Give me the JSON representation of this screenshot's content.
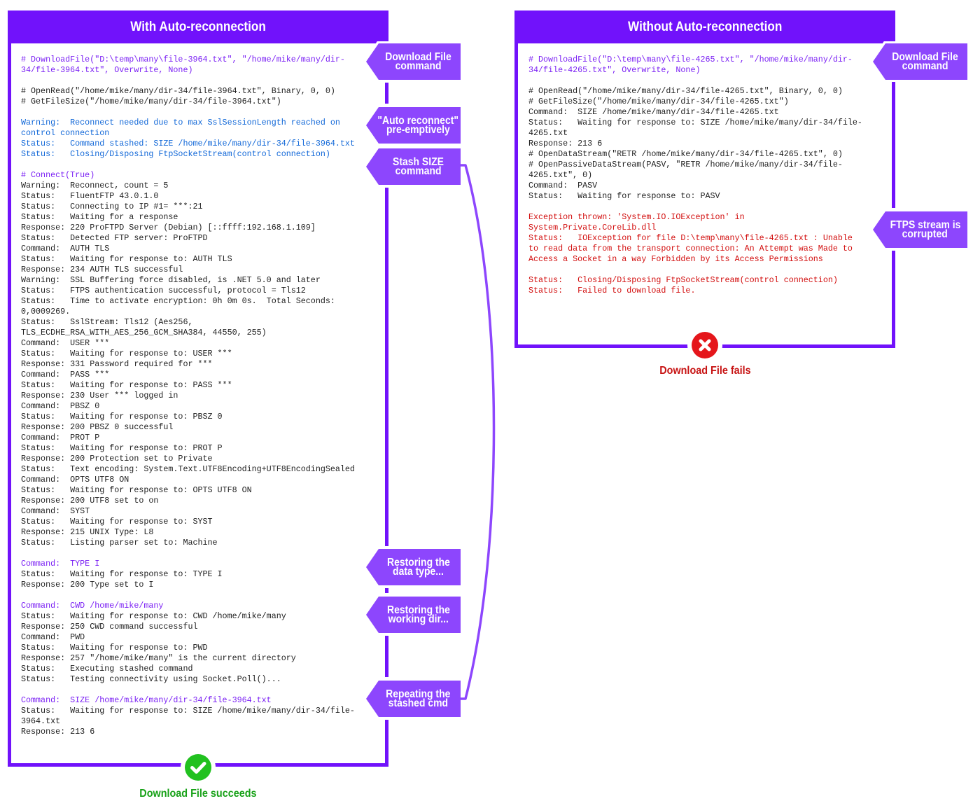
{
  "colors": {
    "frame": "#7112fb",
    "tag": "#8d46fd",
    "success": "#21c11f",
    "success_text": "#17a117",
    "failure": "#e5161b",
    "failure_text": "#c71313"
  },
  "panels": {
    "with": {
      "title": "With Auto-reconnection",
      "log_lines": [
        {
          "t": "# DownloadFile(\"D:\\temp\\many\\file-3964.txt\", \"/home/mike/many/dir-",
          "c": "purple"
        },
        {
          "t": "34/file-3964.txt\", Overwrite, None)",
          "c": "purple"
        },
        {
          "t": "",
          "c": "plain"
        },
        {
          "t": "# OpenRead(\"/home/mike/many/dir-34/file-3964.txt\", Binary, 0, 0)",
          "c": "plain"
        },
        {
          "t": "# GetFileSize(\"/home/mike/many/dir-34/file-3964.txt\")",
          "c": "plain"
        },
        {
          "t": "",
          "c": "plain"
        },
        {
          "t": "Warning:  Reconnect needed due to max SslSessionLength reached on",
          "c": "blue"
        },
        {
          "t": "control connection",
          "c": "blue"
        },
        {
          "t": "Status:   Command stashed: SIZE /home/mike/many/dir-34/file-3964.txt",
          "c": "blue"
        },
        {
          "t": "Status:   Closing/Disposing FtpSocketStream(control connection)",
          "c": "blue"
        },
        {
          "t": "",
          "c": "plain"
        },
        {
          "t": "# Connect(True)",
          "c": "purple"
        },
        {
          "t": "Warning:  Reconnect, count = 5",
          "c": "plain"
        },
        {
          "t": "Status:   FluentFTP 43.0.1.0",
          "c": "plain"
        },
        {
          "t": "Status:   Connecting to IP #1= ***:21",
          "c": "plain"
        },
        {
          "t": "Status:   Waiting for a response",
          "c": "plain"
        },
        {
          "t": "Response: 220 ProFTPD Server (Debian) [::ffff:192.168.1.109]",
          "c": "plain"
        },
        {
          "t": "Status:   Detected FTP server: ProFTPD",
          "c": "plain"
        },
        {
          "t": "Command:  AUTH TLS",
          "c": "plain"
        },
        {
          "t": "Status:   Waiting for response to: AUTH TLS",
          "c": "plain"
        },
        {
          "t": "Response: 234 AUTH TLS successful",
          "c": "plain"
        },
        {
          "t": "Warning:  SSL Buffering force disabled, is .NET 5.0 and later",
          "c": "plain"
        },
        {
          "t": "Status:   FTPS authentication successful, protocol = Tls12",
          "c": "plain"
        },
        {
          "t": "Status:   Time to activate encryption: 0h 0m 0s.  Total Seconds:",
          "c": "plain"
        },
        {
          "t": "0,0009269.",
          "c": "plain"
        },
        {
          "t": "Status:   SslStream: Tls12 (Aes256,",
          "c": "plain"
        },
        {
          "t": "TLS_ECDHE_RSA_WITH_AES_256_GCM_SHA384, 44550, 255)",
          "c": "plain"
        },
        {
          "t": "Command:  USER ***",
          "c": "plain"
        },
        {
          "t": "Status:   Waiting for response to: USER ***",
          "c": "plain"
        },
        {
          "t": "Response: 331 Password required for ***",
          "c": "plain"
        },
        {
          "t": "Command:  PASS ***",
          "c": "plain"
        },
        {
          "t": "Status:   Waiting for response to: PASS ***",
          "c": "plain"
        },
        {
          "t": "Response: 230 User *** logged in",
          "c": "plain"
        },
        {
          "t": "Command:  PBSZ 0",
          "c": "plain"
        },
        {
          "t": "Status:   Waiting for response to: PBSZ 0",
          "c": "plain"
        },
        {
          "t": "Response: 200 PBSZ 0 successful",
          "c": "plain"
        },
        {
          "t": "Command:  PROT P",
          "c": "plain"
        },
        {
          "t": "Status:   Waiting for response to: PROT P",
          "c": "plain"
        },
        {
          "t": "Response: 200 Protection set to Private",
          "c": "plain"
        },
        {
          "t": "Status:   Text encoding: System.Text.UTF8Encoding+UTF8EncodingSealed",
          "c": "plain"
        },
        {
          "t": "Command:  OPTS UTF8 ON",
          "c": "plain"
        },
        {
          "t": "Status:   Waiting for response to: OPTS UTF8 ON",
          "c": "plain"
        },
        {
          "t": "Response: 200 UTF8 set to on",
          "c": "plain"
        },
        {
          "t": "Command:  SYST",
          "c": "plain"
        },
        {
          "t": "Status:   Waiting for response to: SYST",
          "c": "plain"
        },
        {
          "t": "Response: 215 UNIX Type: L8",
          "c": "plain"
        },
        {
          "t": "Status:   Listing parser set to: Machine",
          "c": "plain"
        },
        {
          "t": "",
          "c": "plain"
        },
        {
          "t": "Command:  TYPE I",
          "c": "purple"
        },
        {
          "t": "Status:   Waiting for response to: TYPE I",
          "c": "plain"
        },
        {
          "t": "Response: 200 Type set to I",
          "c": "plain"
        },
        {
          "t": "",
          "c": "plain"
        },
        {
          "t": "Command:  CWD /home/mike/many",
          "c": "purple"
        },
        {
          "t": "Status:   Waiting for response to: CWD /home/mike/many",
          "c": "plain"
        },
        {
          "t": "Response: 250 CWD command successful",
          "c": "plain"
        },
        {
          "t": "Command:  PWD",
          "c": "plain"
        },
        {
          "t": "Status:   Waiting for response to: PWD",
          "c": "plain"
        },
        {
          "t": "Response: 257 \"/home/mike/many\" is the current directory",
          "c": "plain"
        },
        {
          "t": "Status:   Executing stashed command",
          "c": "plain"
        },
        {
          "t": "Status:   Testing connectivity using Socket.Poll()...",
          "c": "plain"
        },
        {
          "t": "",
          "c": "plain"
        },
        {
          "t": "Command:  SIZE /home/mike/many/dir-34/file-3964.txt",
          "c": "purple"
        },
        {
          "t": "Status:   Waiting for response to: SIZE /home/mike/many/dir-34/file-",
          "c": "plain"
        },
        {
          "t": "3964.txt",
          "c": "plain"
        },
        {
          "t": "Response: 213 6",
          "c": "plain"
        }
      ],
      "annotations": [
        {
          "line1": "Download File",
          "line2": "command"
        },
        {
          "line1": "\"Auto reconnect\"",
          "line2": "pre-emptively"
        },
        {
          "line1": "Stash SIZE",
          "line2": "command"
        },
        {
          "line1": "Restoring the",
          "line2": "data type..."
        },
        {
          "line1": "Restoring the",
          "line2": "working dir..."
        },
        {
          "line1": "Repeating the",
          "line2": "stashed cmd"
        }
      ],
      "result": {
        "label": "Download File succeeds",
        "status": "success",
        "icon": "check-circle-icon"
      }
    },
    "without": {
      "title": "Without Auto-reconnection",
      "log_lines": [
        {
          "t": "# DownloadFile(\"D:\\temp\\many\\file-4265.txt\", \"/home/mike/many/dir-",
          "c": "purple"
        },
        {
          "t": "34/file-4265.txt\", Overwrite, None)",
          "c": "purple"
        },
        {
          "t": "",
          "c": "plain"
        },
        {
          "t": "# OpenRead(\"/home/mike/many/dir-34/file-4265.txt\", Binary, 0, 0)",
          "c": "plain"
        },
        {
          "t": "# GetFileSize(\"/home/mike/many/dir-34/file-4265.txt\")",
          "c": "plain"
        },
        {
          "t": "Command:  SIZE /home/mike/many/dir-34/file-4265.txt",
          "c": "plain"
        },
        {
          "t": "Status:   Waiting for response to: SIZE /home/mike/many/dir-34/file-",
          "c": "plain"
        },
        {
          "t": "4265.txt",
          "c": "plain"
        },
        {
          "t": "Response: 213 6",
          "c": "plain"
        },
        {
          "t": "# OpenDataStream(\"RETR /home/mike/many/dir-34/file-4265.txt\", 0)",
          "c": "plain"
        },
        {
          "t": "# OpenPassiveDataStream(PASV, \"RETR /home/mike/many/dir-34/file-",
          "c": "plain"
        },
        {
          "t": "4265.txt\", 0)",
          "c": "plain"
        },
        {
          "t": "Command:  PASV",
          "c": "plain"
        },
        {
          "t": "Status:   Waiting for response to: PASV",
          "c": "plain"
        },
        {
          "t": "",
          "c": "plain"
        },
        {
          "t": "Exception thrown: 'System.IO.IOException' in",
          "c": "red"
        },
        {
          "t": "System.Private.CoreLib.dll",
          "c": "red"
        },
        {
          "t": "Status:   IOException for file D:\\temp\\many\\file-4265.txt : Unable",
          "c": "red"
        },
        {
          "t": "to read data from the transport connection: An Attempt was Made to",
          "c": "red"
        },
        {
          "t": "Access a Socket in a way Forbidden by its Access Permissions",
          "c": "red"
        },
        {
          "t": "",
          "c": "plain"
        },
        {
          "t": "Status:   Closing/Disposing FtpSocketStream(control connection)",
          "c": "red"
        },
        {
          "t": "Status:   Failed to download file.",
          "c": "red"
        }
      ],
      "annotations": [
        {
          "line1": "Download File",
          "line2": "command"
        },
        {
          "line1": "FTPS stream is",
          "line2": "corrupted"
        }
      ],
      "result": {
        "label": "Download File fails",
        "status": "failure",
        "icon": "x-circle-icon"
      }
    }
  }
}
